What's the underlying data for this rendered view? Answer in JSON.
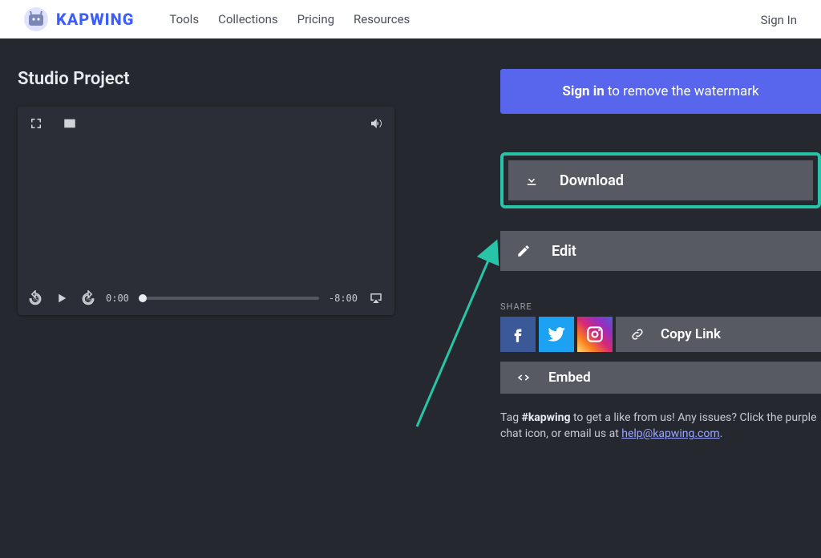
{
  "nav": {
    "brand": "KAPWING",
    "links": [
      "Tools",
      "Collections",
      "Pricing",
      "Resources"
    ],
    "signin": "Sign In"
  },
  "page": {
    "title": "Studio Project"
  },
  "player": {
    "current_time": "0:00",
    "remaining_time": "-8:00"
  },
  "panel": {
    "banner_strong": "Sign in",
    "banner_rest": " to remove the watermark",
    "download": "Download",
    "edit": "Edit",
    "share_label": "SHARE",
    "copy_link": "Copy Link",
    "embed": "Embed",
    "footnote_pre": "Tag ",
    "footnote_tag": "#kapwing",
    "footnote_mid": " to get a like from us! Any issues? Click the purple chat icon, or email us at ",
    "footnote_email": "help@kapwing.com",
    "footnote_post": "."
  }
}
